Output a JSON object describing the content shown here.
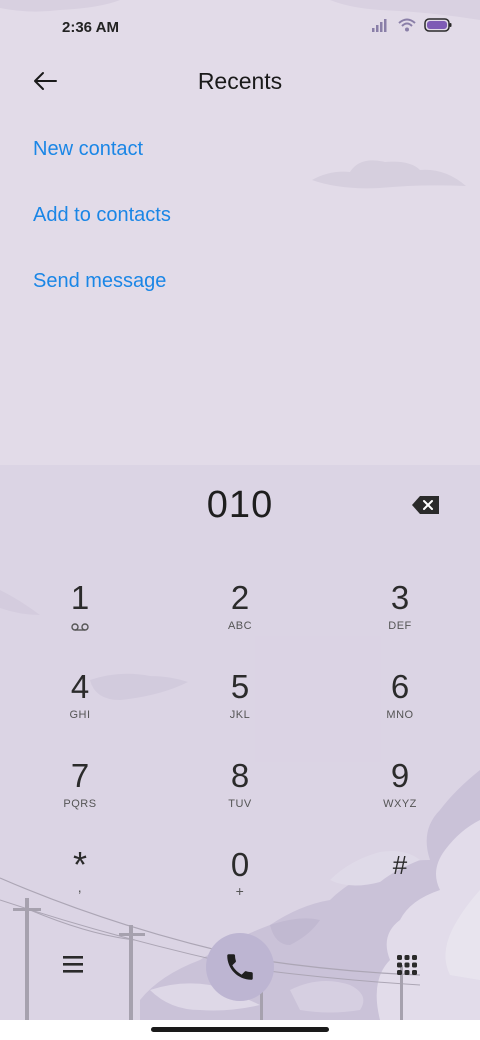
{
  "status_bar": {
    "time": "2:36 AM",
    "icons": [
      "signal-icon",
      "wifi-icon",
      "battery-icon"
    ]
  },
  "header": {
    "title": "Recents",
    "back_icon": "arrow-left-icon"
  },
  "menu": {
    "items": [
      {
        "label": "New contact"
      },
      {
        "label": "Add to contacts"
      },
      {
        "label": "Send message"
      }
    ]
  },
  "dialer": {
    "number": "010",
    "backspace_icon": "backspace-icon",
    "keys": [
      {
        "digit": "1",
        "letters": ""
      },
      {
        "digit": "2",
        "letters": "ABC"
      },
      {
        "digit": "3",
        "letters": "DEF"
      },
      {
        "digit": "4",
        "letters": "GHI"
      },
      {
        "digit": "5",
        "letters": "JKL"
      },
      {
        "digit": "6",
        "letters": "MNO"
      },
      {
        "digit": "7",
        "letters": "PQRS"
      },
      {
        "digit": "8",
        "letters": "TUV"
      },
      {
        "digit": "9",
        "letters": "WXYZ"
      },
      {
        "digit": "*",
        "letters": ","
      },
      {
        "digit": "0",
        "letters": "+"
      },
      {
        "digit": "#",
        "letters": ""
      }
    ],
    "voicemail_icon": "voicemail-icon"
  },
  "bottom_bar": {
    "menu_icon": "hamburger-menu-icon",
    "call_icon": "phone-icon",
    "keypad_icon": "keypad-icon"
  },
  "colors": {
    "accent": "#1a86e6",
    "background": "#e2dbe8",
    "call_button": "#bdb5d2"
  }
}
